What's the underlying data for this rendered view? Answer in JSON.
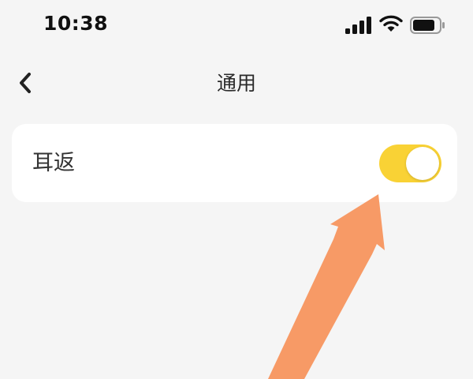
{
  "status_bar": {
    "time": "10:38",
    "icons": [
      "signal-icon",
      "wifi-icon",
      "battery-icon"
    ]
  },
  "nav": {
    "title": "通用",
    "back_icon": "chevron-left-icon"
  },
  "settings": {
    "items": [
      {
        "label": "耳返",
        "enabled": true
      }
    ]
  },
  "colors": {
    "background": "#f5f5f5",
    "card": "#ffffff",
    "toggle_on": "#f9d235",
    "annotation_arrow": "#f79a66"
  }
}
